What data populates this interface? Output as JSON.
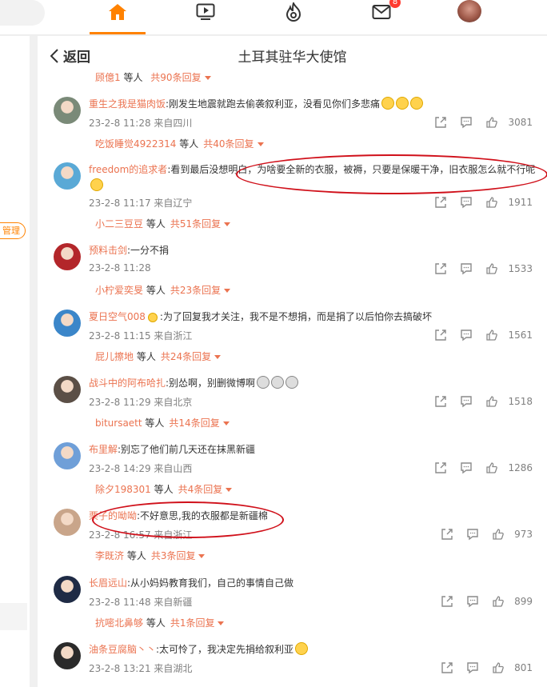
{
  "topbar": {
    "nav": [
      {
        "name": "home-icon",
        "active": true
      },
      {
        "name": "video-icon"
      },
      {
        "name": "hot-icon"
      },
      {
        "name": "message-icon"
      },
      {
        "name": "user-avatar"
      }
    ],
    "message_badge": "8"
  },
  "left": {
    "manage_label": "管理"
  },
  "header": {
    "back_label": "返回",
    "title": "土耳其驻华大使馆"
  },
  "top_partial": {
    "user": "顾億1",
    "suffix": " 等人",
    "total": "共90条回复"
  },
  "comments": [
    {
      "username": "重生之我是猫肉饭",
      "text": ":刚发生地震就跑去偷袭叙利亚，没看见你们多悲痛",
      "emojis": 3,
      "emoji_style": "laugh",
      "time": "23-2-8 11:28 来自四川",
      "likes": "3081",
      "reply_user": "吃饭睡觉4922314",
      "reply_suffix": " 等人",
      "reply_total": "共40条回复",
      "avatar": "#7a8a78"
    },
    {
      "username": "freedom的追求者",
      "text": ":看到最后没想明白，为啥要全新的衣服，被褥，只要是保暖干净，旧衣服怎么就不行呢",
      "emojis": 1,
      "emoji_style": "laugh",
      "emoji_newline": true,
      "time": "23-2-8 11:17 来自辽宁",
      "likes": "1911",
      "reply_user": "小二三豆豆",
      "reply_suffix": " 等人",
      "reply_total": "共51条回复",
      "avatar": "#5aa9d6"
    },
    {
      "username": "预料击剑",
      "text": ":一分不捐",
      "emojis": 0,
      "time": "23-2-8 11:28",
      "likes": "1533",
      "reply_user": "小柠爱奕旻",
      "reply_suffix": " 等人",
      "reply_total": "共23条回复",
      "avatar": "#b3262a"
    },
    {
      "username": "夏日空气008",
      "text": ":为了回复我才关注，我不是不想捐，而是捐了以后怕你去搞破坏",
      "emojis": 0,
      "badge": true,
      "time": "23-2-8 11:15 来自浙江",
      "likes": "1561",
      "reply_user": "屁儿擦地",
      "reply_suffix": " 等人",
      "reply_total": "共24条回复",
      "avatar": "#3b86c9"
    },
    {
      "username": "战斗中的阿布哈扎",
      "text": ":别怂啊，别删微博啊",
      "emojis": 3,
      "emoji_style": "grey",
      "time": "23-2-8 11:29 来自北京",
      "likes": "1518",
      "reply_user": "bitursaett",
      "reply_suffix": " 等人",
      "reply_total": "共14条回复",
      "avatar": "#5b4f46"
    },
    {
      "username": "布里解",
      "text": ":别忘了他们前几天还在抹黑新疆",
      "emojis": 0,
      "time": "23-2-8 14:29 来自山西",
      "likes": "1286",
      "reply_user": "除夕198301",
      "reply_suffix": " 等人",
      "reply_total": "共4条回复",
      "avatar": "#6f9fd8"
    },
    {
      "username": "栗子的呦呦",
      "text": ":不好意思,我的衣服都是新疆棉",
      "emojis": 0,
      "time": "23-2-8 16:57 来自浙江",
      "likes": "973",
      "reply_user": "李既济",
      "reply_suffix": " 等人",
      "reply_total": "共3条回复",
      "avatar": "#c9a58a"
    },
    {
      "username": "长眉远山",
      "text": ":从小妈妈教育我们，自己的事情自己做",
      "emojis": 0,
      "time": "23-2-8 11:48 来自新疆",
      "likes": "899",
      "reply_user": "抗嘧北鼻够",
      "reply_suffix": " 等人",
      "reply_total": "共1条回复",
      "avatar": "#1f2b45"
    },
    {
      "username": "油条豆腐脑丶丶",
      "text": ":太可怜了，我决定先捐给叙利亚",
      "emojis": 1,
      "emoji_style": "cry",
      "time": "23-2-8 13:21 来自湖北",
      "likes": "801",
      "avatar": "#2a2a2a"
    }
  ]
}
